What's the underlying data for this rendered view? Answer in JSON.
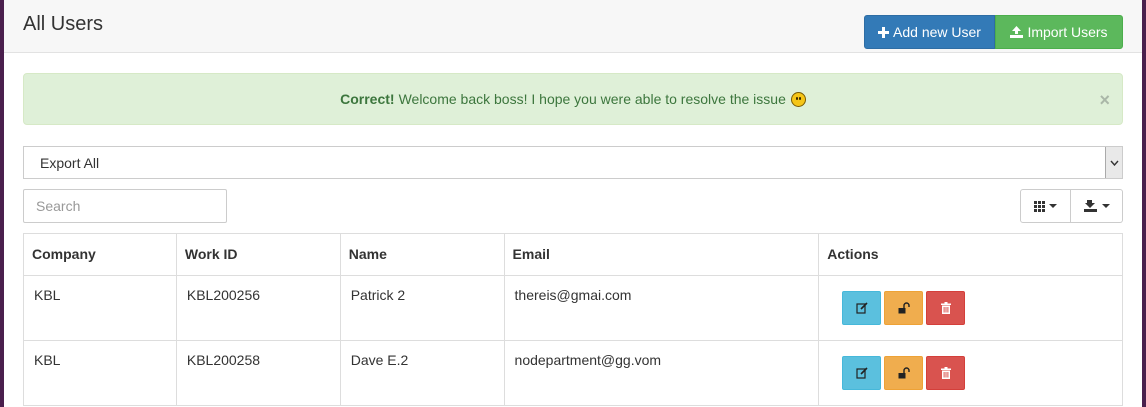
{
  "page": {
    "title": "All Users"
  },
  "toolbar": {
    "add_label": "Add new User",
    "import_label": "Import Users"
  },
  "alert": {
    "strong": "Correct!",
    "message": "Welcome back boss! I hope you were able to resolve the issue",
    "close": "×",
    "color": "#3c763d"
  },
  "export": {
    "selected": "Export All"
  },
  "search": {
    "placeholder": "Search",
    "value": ""
  },
  "table": {
    "columns": [
      "Company",
      "Work ID",
      "Name",
      "Email",
      "Actions"
    ],
    "rows": [
      {
        "company": "KBL",
        "work_id": "KBL200256",
        "name": "Patrick 2",
        "email": "thereis@gmai.com"
      },
      {
        "company": "KBL",
        "work_id": "KBL200258",
        "name": "Dave E.2",
        "email": "nodepartment@gg.vom"
      }
    ]
  },
  "icons": {
    "add": "plus-icon",
    "import": "upload-icon",
    "columns": "grid-icon",
    "export_tool": "export-icon",
    "edit": "edit-icon",
    "unlock": "unlock-icon",
    "delete": "trash-icon"
  },
  "colors": {
    "primary": "#337ab7",
    "success": "#5cb85c",
    "info": "#5bc0de",
    "warning": "#f0ad4e",
    "danger": "#d9534f",
    "frame": "#4a1f4d"
  }
}
